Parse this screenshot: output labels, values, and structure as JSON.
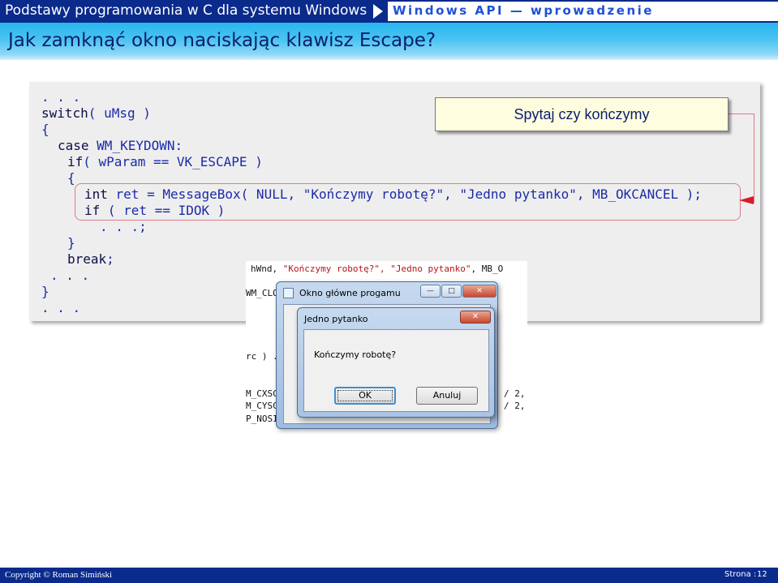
{
  "header": {
    "course": "Podstawy programowania w C dla systemu Windows",
    "module": "Windows API — wprowadzenie",
    "slide_title": "Jak zamknąć okno naciskając klawisz Escape?"
  },
  "code": {
    "l1": ". . .",
    "l2_kw": "switch",
    "l2_rest": "( uMsg )",
    "l3": "{",
    "l4_kw": "case",
    "l4_rest": " WM_KEYDOWN:",
    "l5_kw": "if",
    "l5_rest": "( wParam == VK_ESCAPE )",
    "l6": "{",
    "l7_kw": "int",
    "l7_rest": " ret = MessageBox( NULL, \"Kończymy robotę?\", \"Jedno pytanko\", MB_OKCANCEL );",
    "l8_kw": "if",
    "l8_rest": " ( ret == IDOK )",
    "l9": ". . .;",
    "l10": "}",
    "l11_kw": "break",
    "l11_rest": ";",
    "l12": ". . .",
    "l13": "}",
    "l14": ". . ."
  },
  "callout": "Spytaj czy kończymy",
  "screenshot": {
    "bg_line1_pre": "hWnd, ",
    "bg_line1_str": "\"Kończymy robotę?\", \"Jedno pytanko\"",
    "bg_line1_post": ", MB_O",
    "bg_line2": "WM_CLO",
    "bg_line3": "rc ) .",
    "bg_line4": "M_CXSC",
    "bg_line5": "M_CYSC",
    "bg_line6": "P_NOSI",
    "bg_line4_r": "/ 2,",
    "bg_line5_r": "/ 2,",
    "main_window_title": "Okno główne progamu",
    "minimize": "—",
    "maximize": "□",
    "close": "✕",
    "dialog_title": "Jedno pytanko",
    "dialog_message": "Kończymy robotę?",
    "ok_label": "OK",
    "cancel_label": "Anuluj"
  },
  "footer": {
    "copyright": "Copyright © Roman Simiński",
    "page_label": "Strona :",
    "page_number": "12"
  },
  "colors": {
    "header_bar": "#0a2a8c",
    "title_gradient_top": "#29b6ef",
    "code_text": "#1c2aa8",
    "highlight": "#e07a8a",
    "arrow": "#d81b28",
    "callout_bg": "#fffde0"
  }
}
